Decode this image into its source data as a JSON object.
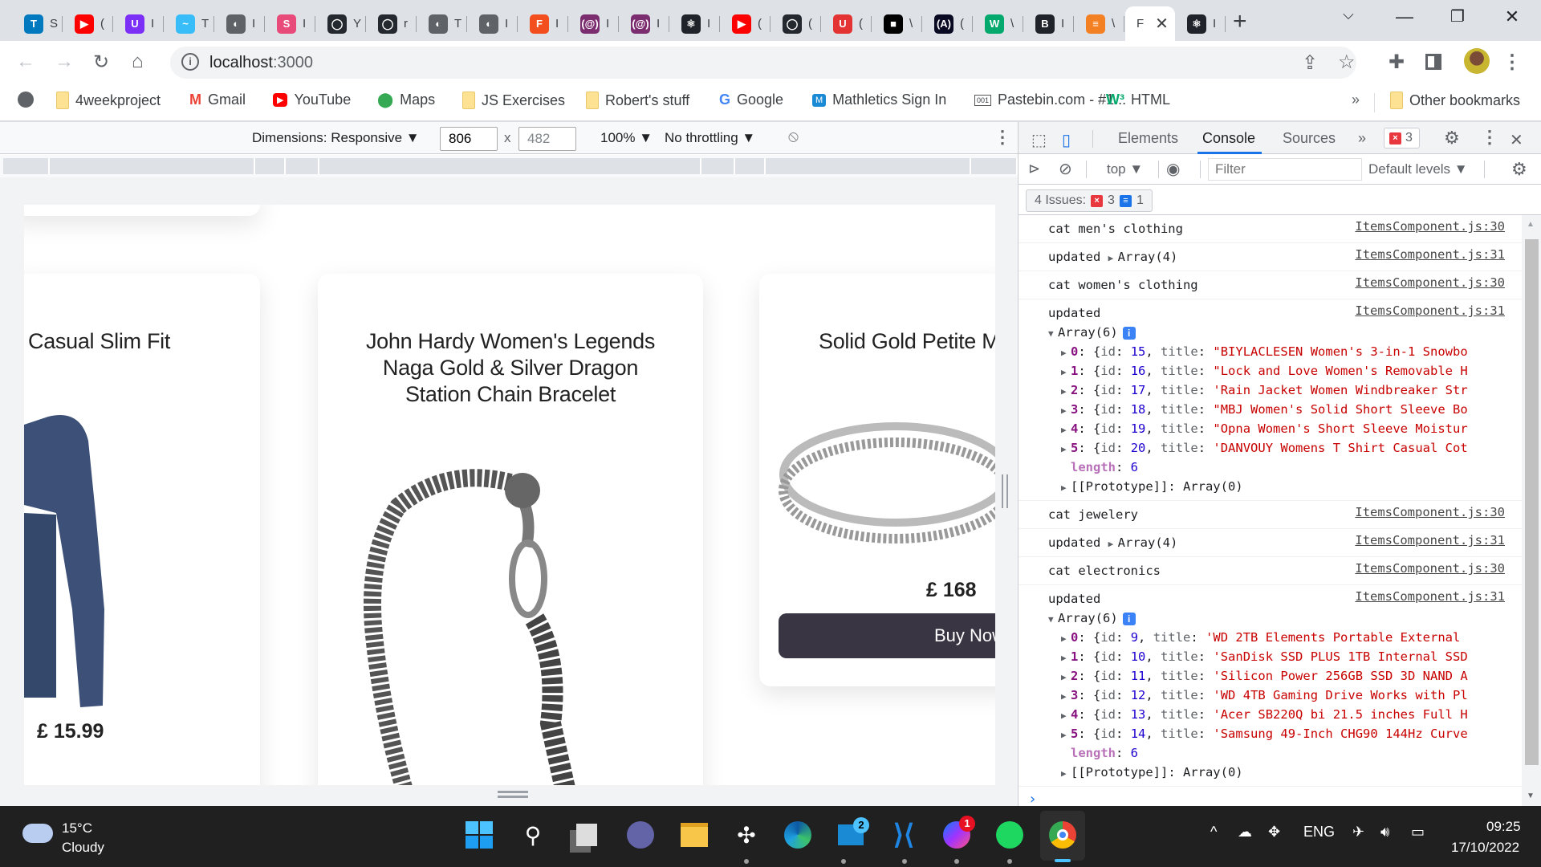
{
  "browser": {
    "tabs": [
      {
        "name": "trello",
        "letter": "T",
        "color": "#0079bf",
        "title": "S"
      },
      {
        "name": "youtube",
        "letter": "▶",
        "color": "#ff0000",
        "title": "("
      },
      {
        "name": "uplabs",
        "letter": "U",
        "color": "#7b2ff7",
        "title": "I"
      },
      {
        "name": "tailwind",
        "letter": "~",
        "color": "#38bdf8",
        "title": "T"
      },
      {
        "name": "globe",
        "letter": "◐",
        "color": "#5f6368",
        "title": "I"
      },
      {
        "name": "stylebot",
        "letter": "S",
        "color": "#e84a7a",
        "title": "I"
      },
      {
        "name": "github",
        "letter": "◯",
        "color": "#24292f",
        "title": "Y"
      },
      {
        "name": "github",
        "letter": "◯",
        "color": "#24292f",
        "title": "r"
      },
      {
        "name": "globe",
        "letter": "◐",
        "color": "#5f6368",
        "title": "T"
      },
      {
        "name": "globe",
        "letter": "◐",
        "color": "#5f6368",
        "title": "I"
      },
      {
        "name": "figma",
        "letter": "F",
        "color": "#f24e1e",
        "title": "I"
      },
      {
        "name": "regex",
        "letter": "(@)",
        "color": "#7b2d6f",
        "title": "I"
      },
      {
        "name": "regex",
        "letter": "(@)",
        "color": "#7b2d6f",
        "title": "I"
      },
      {
        "name": "react",
        "letter": "⚛",
        "color": "#20232a",
        "title": "I"
      },
      {
        "name": "youtube",
        "letter": "▶",
        "color": "#ff0000",
        "title": "("
      },
      {
        "name": "github",
        "letter": "◯",
        "color": "#24292f",
        "title": "("
      },
      {
        "name": "testing-lib",
        "letter": "U",
        "color": "#e33332",
        "title": "("
      },
      {
        "name": "unsplash",
        "letter": "■",
        "color": "#000000",
        "title": "\\"
      },
      {
        "name": "freecodecamp",
        "letter": "(A)",
        "color": "#0a0a23",
        "title": "("
      },
      {
        "name": "w3schools",
        "letter": "W",
        "color": "#04aa6d",
        "title": "\\"
      },
      {
        "name": "react-bootstrap",
        "letter": "B",
        "color": "#20232a",
        "title": "I"
      },
      {
        "name": "stackoverflow",
        "letter": "≡",
        "color": "#f48024",
        "title": "\\"
      },
      {
        "name": "active",
        "letter": "",
        "color": "",
        "title": "F",
        "active": true
      },
      {
        "name": "react",
        "letter": "⚛",
        "color": "#20232a",
        "title": "I"
      }
    ],
    "new_tab": "+",
    "url_host": "localhost",
    "url_port": ":3000",
    "bookmarks": [
      {
        "label": "4weekproject",
        "icon": "folder"
      },
      {
        "label": "Gmail",
        "icon": "gmail"
      },
      {
        "label": "YouTube",
        "icon": "youtube"
      },
      {
        "label": "Maps",
        "icon": "maps"
      },
      {
        "label": "JS Exercises",
        "icon": "folder"
      },
      {
        "label": "Robert's stuff",
        "icon": "folder"
      },
      {
        "label": "Google",
        "icon": "google"
      },
      {
        "label": "Mathletics Sign In",
        "icon": "mathletics"
      },
      {
        "label": "Pastebin.com - #1...",
        "icon": "pastebin"
      },
      {
        "label": "HTML",
        "icon": "w3schools"
      }
    ],
    "overflow": "»",
    "other_bookmarks": "Other bookmarks"
  },
  "device_toolbar": {
    "dimensions": "Dimensions: Responsive ▼",
    "width": "806",
    "height": "482",
    "times": "x",
    "zoom": "100% ▼",
    "throttling": "No throttling ▼"
  },
  "page": {
    "products": [
      {
        "title": "Casual Slim Fit",
        "price": "£ 15.99"
      },
      {
        "title": "John Hardy Women's Legends Naga Gold & Silver Dragon Station Chain Bracelet",
        "price": ""
      },
      {
        "title": "Solid Gold Petite M",
        "price": "£ 168",
        "button": "Buy Now"
      }
    ]
  },
  "devtools": {
    "tabs": [
      "Elements",
      "Console",
      "Sources"
    ],
    "active_tab": "Console",
    "more_tabs": "»",
    "error_count": "3",
    "context": "top ▼",
    "filter_placeholder": "Filter",
    "levels": "Default levels ▼",
    "issues_label": "4 Issues:",
    "issues_errors": "3",
    "issues_info": "1",
    "console": [
      {
        "type": "log",
        "text": "cat men's clothing",
        "source": "ItemsComponent.js:30"
      },
      {
        "type": "collapsed",
        "prefix": "updated",
        "array": "Array(4)",
        "source": "ItemsComponent.js:31"
      },
      {
        "type": "log",
        "text": "cat women's clothing",
        "source": "ItemsComponent.js:30"
      },
      {
        "type": "expanded",
        "prefix": "updated",
        "array": "Array(6)",
        "source": "ItemsComponent.js:31",
        "items": [
          {
            "i": "0",
            "id": "15",
            "q": "\"",
            "title": "BIYLACLESEN Women's 3-in-1 Snowbo"
          },
          {
            "i": "1",
            "id": "16",
            "q": "\"",
            "title": "Lock and Love Women's Removable H"
          },
          {
            "i": "2",
            "id": "17",
            "q": "'",
            "title": "Rain Jacket Women Windbreaker Str"
          },
          {
            "i": "3",
            "id": "18",
            "q": "\"",
            "title": "MBJ Women's Solid Short Sleeve Bo"
          },
          {
            "i": "4",
            "id": "19",
            "q": "\"",
            "title": "Opna Women's Short Sleeve Moistur"
          },
          {
            "i": "5",
            "id": "20",
            "q": "'",
            "title": "DANVOUY Womens T Shirt Casual Cot"
          }
        ],
        "length": "6",
        "prototype": "[[Prototype]]: Array(0)"
      },
      {
        "type": "log",
        "text": "cat jewelery",
        "source": "ItemsComponent.js:30"
      },
      {
        "type": "collapsed",
        "prefix": "updated",
        "array": "Array(4)",
        "source": "ItemsComponent.js:31"
      },
      {
        "type": "log",
        "text": "cat electronics",
        "source": "ItemsComponent.js:30"
      },
      {
        "type": "expanded",
        "prefix": "updated",
        "array": "Array(6)",
        "source": "ItemsComponent.js:31",
        "items": [
          {
            "i": "0",
            "id": "9",
            "q": "'",
            "title": "WD 2TB Elements Portable External"
          },
          {
            "i": "1",
            "id": "10",
            "q": "'",
            "title": "SanDisk SSD PLUS 1TB Internal SSD"
          },
          {
            "i": "2",
            "id": "11",
            "q": "'",
            "title": "Silicon Power 256GB SSD 3D NAND A"
          },
          {
            "i": "3",
            "id": "12",
            "q": "'",
            "title": "WD 4TB Gaming Drive Works with Pl"
          },
          {
            "i": "4",
            "id": "13",
            "q": "'",
            "title": "Acer SB220Q bi 21.5 inches Full H"
          },
          {
            "i": "5",
            "id": "14",
            "q": "'",
            "title": "Samsung 49-Inch CHG90 144Hz Curve"
          }
        ],
        "length": "6",
        "prototype": "[[Prototype]]: Array(0)"
      }
    ],
    "prompt": "›"
  },
  "taskbar": {
    "weather_temp": "15°C",
    "weather_desc": "Cloudy",
    "mail_badge": "2",
    "messenger_badge": "1",
    "language": "ENG",
    "time": "09:25",
    "date": "17/10/2022"
  }
}
